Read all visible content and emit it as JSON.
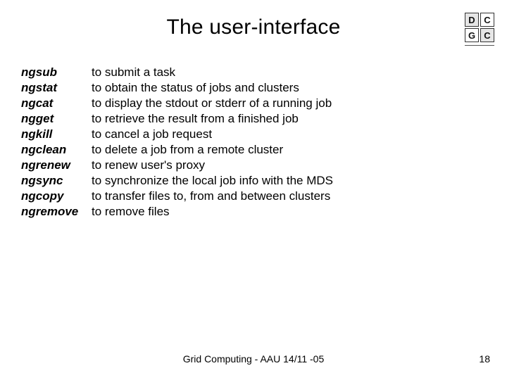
{
  "title": "The user-interface",
  "logo": {
    "tl": "D",
    "tr": "C",
    "bl": "G",
    "br": "C"
  },
  "commands": [
    {
      "name": "ngsub",
      "desc": "to submit a task"
    },
    {
      "name": "ngstat",
      "desc": "to  obtain the status of jobs and clusters"
    },
    {
      "name": "ngcat",
      "desc": "to  display the stdout or stderr of a running job"
    },
    {
      "name": "ngget",
      "desc": "to  retrieve the result from a finished job"
    },
    {
      "name": "ngkill",
      "desc": "to  cancel a job request"
    },
    {
      "name": "ngclean",
      "desc": "to  delete a job from a remote cluster"
    },
    {
      "name": "ngrenew",
      "desc": "to renew user's proxy"
    },
    {
      "name": "ngsync",
      "desc": "to  synchronize the local job info with the MDS"
    },
    {
      "name": "ngcopy",
      "desc": "to  transfer files to, from and between clusters"
    },
    {
      "name": "ngremove",
      "desc": "to  remove files"
    }
  ],
  "footer": "Grid Computing - AAU 14/11 -05",
  "page": "18"
}
